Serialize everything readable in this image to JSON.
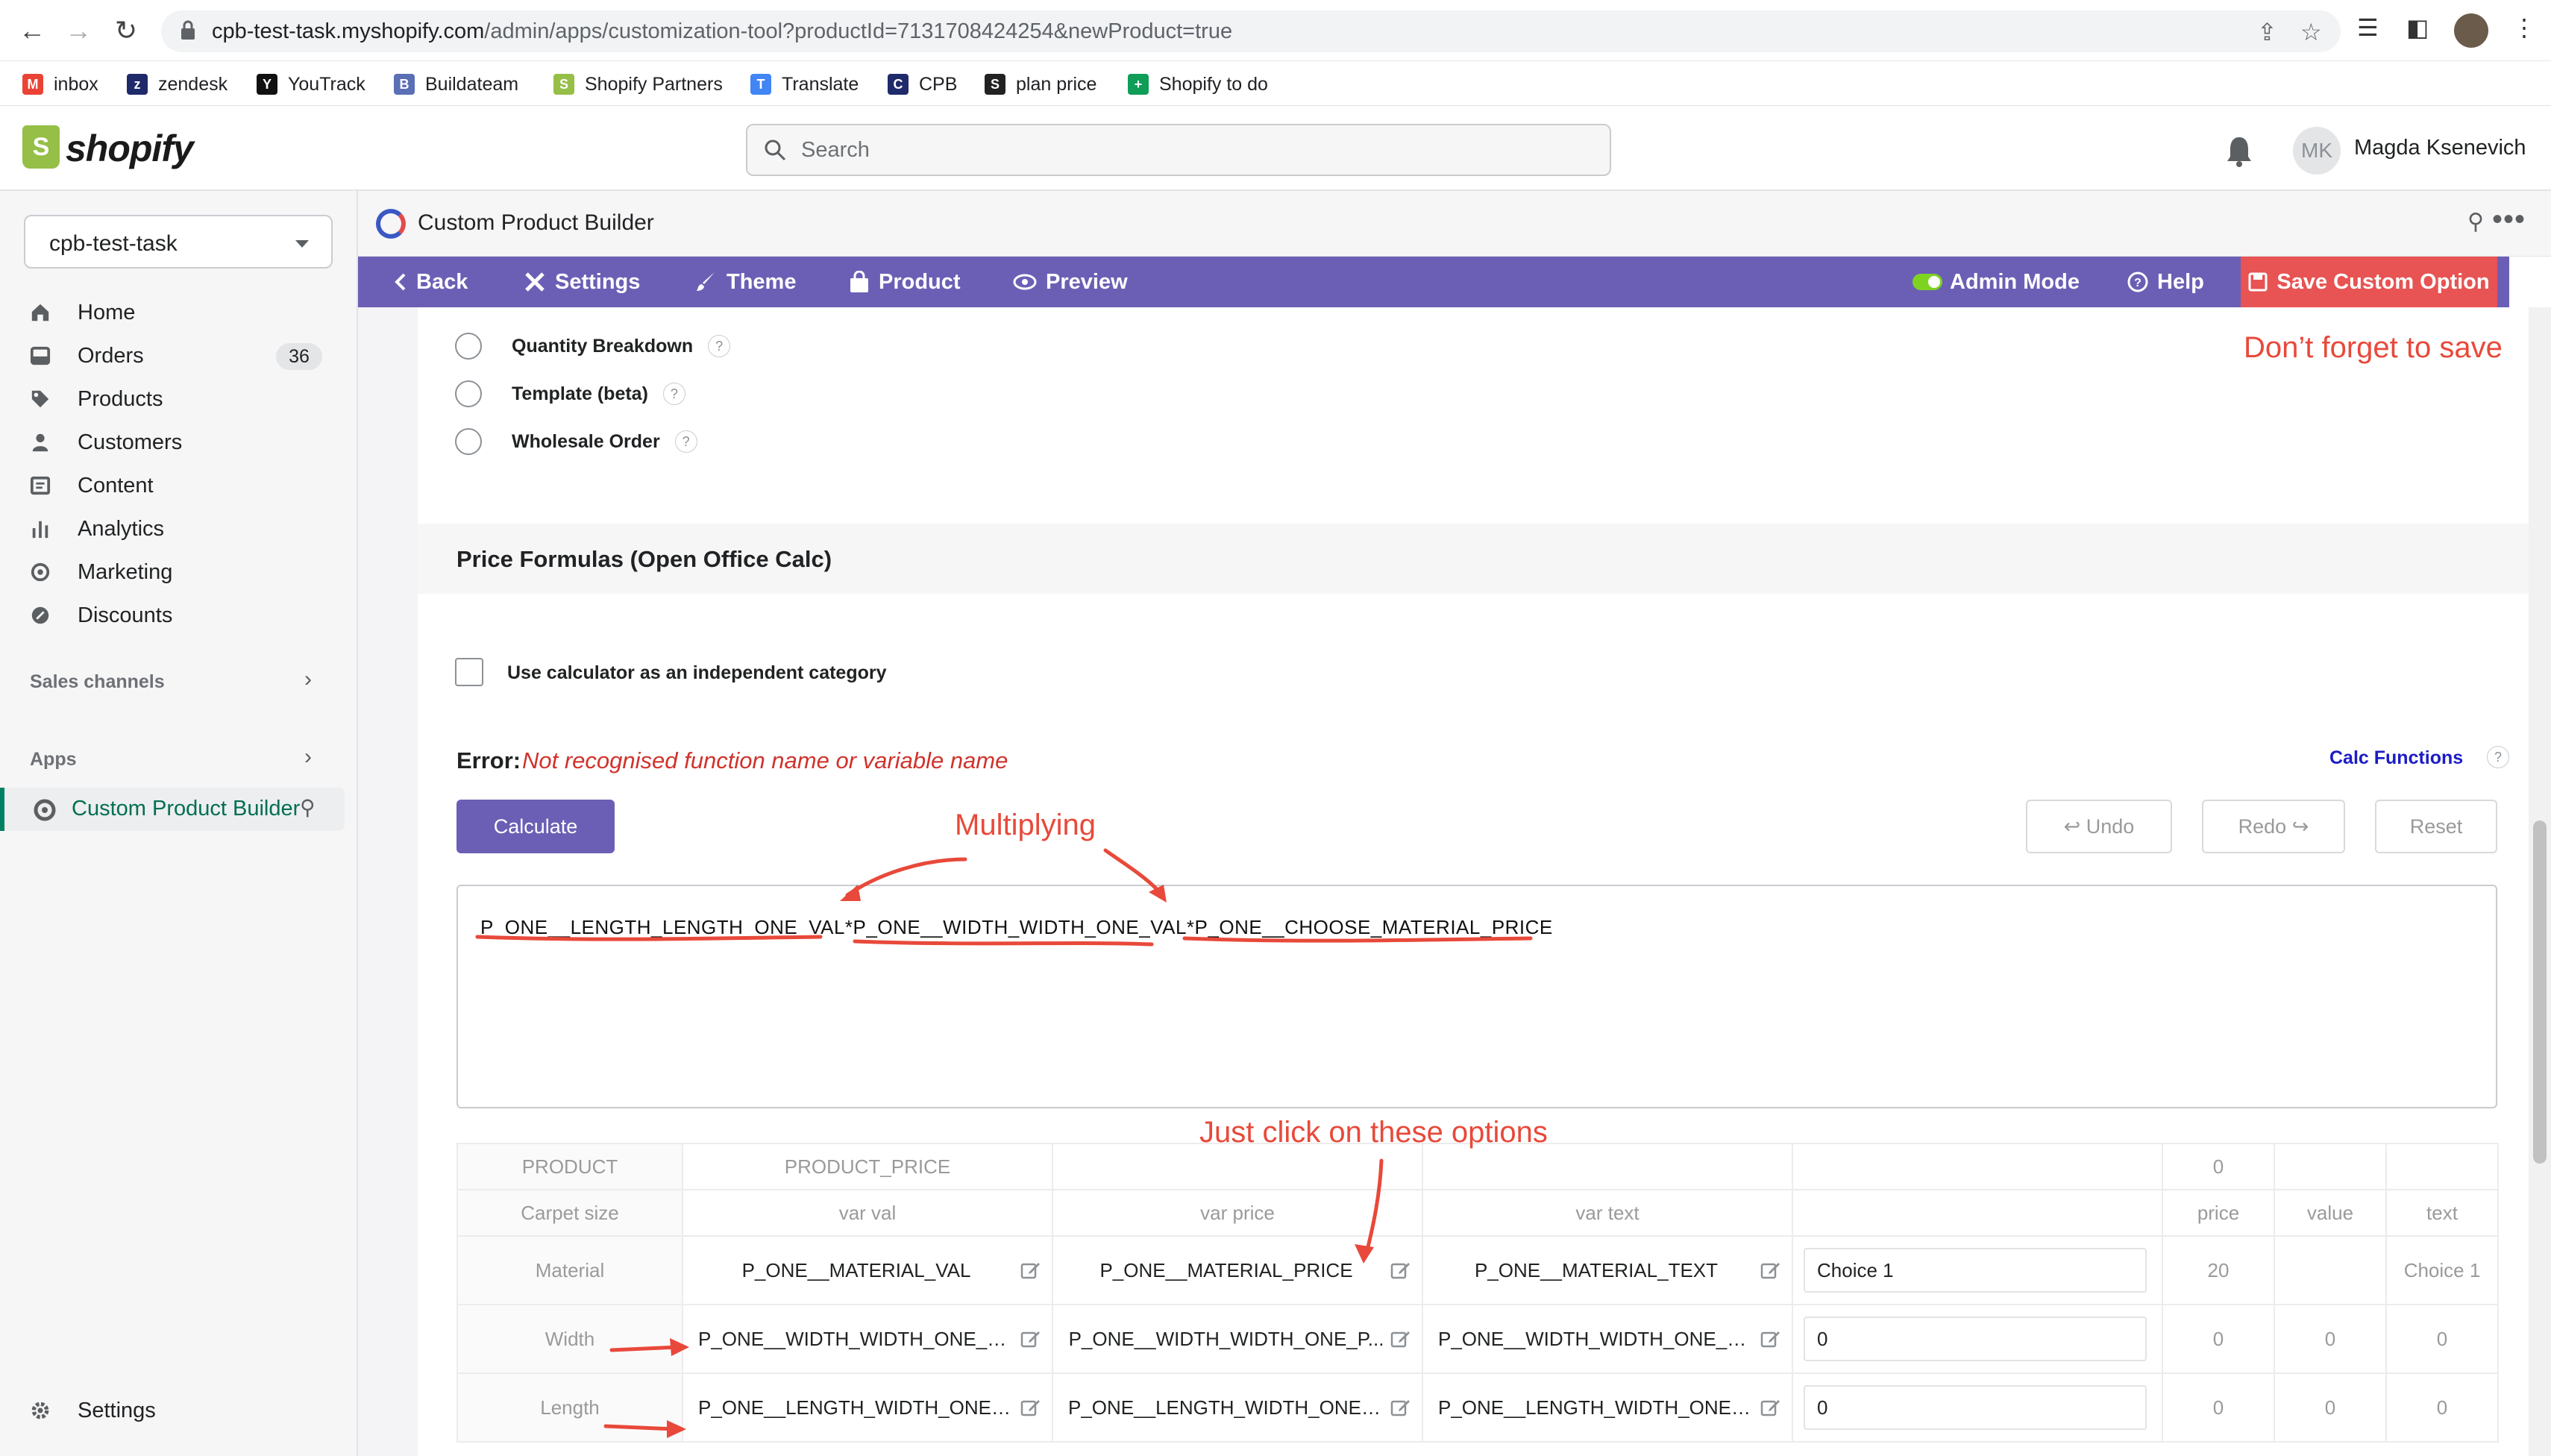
{
  "browser": {
    "url_host": "cpb-test-task.myshopify.com",
    "url_path": "/admin/apps/customization-tool?productId=7131708424254&newProduct=true",
    "bookmarks": [
      {
        "label": "inbox",
        "color": "#ea4335",
        "glyph": "M"
      },
      {
        "label": "zendesk",
        "color": "#1f2a6b",
        "glyph": "z"
      },
      {
        "label": "YouTrack",
        "color": "#111111",
        "glyph": "Y"
      },
      {
        "label": "Buildateam",
        "color": "#5b6fb5",
        "glyph": "B"
      },
      {
        "label": "Shopify Partners",
        "color": "#95bf47",
        "glyph": "S"
      },
      {
        "label": "Translate",
        "color": "#4285f4",
        "glyph": "T"
      },
      {
        "label": "CPB",
        "color": "#1f2a6b",
        "glyph": "C"
      },
      {
        "label": "plan price",
        "color": "#222222",
        "glyph": "S"
      },
      {
        "label": "Shopify to do",
        "color": "#0f9d58",
        "glyph": "+"
      }
    ]
  },
  "shopify": {
    "logo_text": "shopify",
    "search_placeholder": "Search",
    "user_initials": "MK",
    "user_name": "Magda Ksenevich"
  },
  "sidebar": {
    "store": "cpb-test-task",
    "items": [
      {
        "label": "Home",
        "icon": "home-icon"
      },
      {
        "label": "Orders",
        "icon": "orders-icon",
        "badge": "36"
      },
      {
        "label": "Products",
        "icon": "tag-icon"
      },
      {
        "label": "Customers",
        "icon": "person-icon"
      },
      {
        "label": "Content",
        "icon": "content-icon"
      },
      {
        "label": "Analytics",
        "icon": "analytics-icon"
      },
      {
        "label": "Marketing",
        "icon": "marketing-icon"
      },
      {
        "label": "Discounts",
        "icon": "discount-icon"
      }
    ],
    "sales_channels": "Sales channels",
    "apps": "Apps",
    "active_app": "Custom Product Builder",
    "settings": "Settings"
  },
  "app": {
    "title": "Custom Product Builder",
    "toolbar": {
      "back": "Back",
      "settings": "Settings",
      "theme": "Theme",
      "product": "Product",
      "preview": "Preview",
      "admin_mode": "Admin Mode",
      "help": "Help",
      "save": "Save Custom Option"
    },
    "options": [
      {
        "label": "Quantity Breakdown"
      },
      {
        "label": "Template (beta)"
      },
      {
        "label": "Wholesale Order"
      }
    ],
    "section_title": "Price Formulas (Open Office Calc)",
    "calc_checkbox_label": "Use calculator as an independent category",
    "error_label": "Error:",
    "error_message": "Not recognised function name or variable name",
    "calc_functions": "Calc Functions",
    "buttons": {
      "calculate": "Calculate",
      "undo": "↩ Undo",
      "redo": "Redo ↪",
      "reset": "Reset"
    },
    "formula": "P_ONE__LENGTH_LENGTH_ONE_VAL*P_ONE__WIDTH_WIDTH_ONE_VAL*P_ONE__CHOOSE_MATERIAL_PRICE",
    "table": {
      "header1": {
        "product": "PRODUCT",
        "product_price": "PRODUCT_PRICE",
        "qty": "0"
      },
      "header2": {
        "name": "Carpet size",
        "var_val": "var val",
        "var_price": "var price",
        "var_text": "var text",
        "price": "price",
        "value": "value",
        "text": "text"
      },
      "rows": [
        {
          "name": "Material",
          "var_val": "P_ONE__MATERIAL_VAL",
          "var_price": "P_ONE__MATERIAL_PRICE",
          "var_text": "P_ONE__MATERIAL_TEXT",
          "input": "Choice 1",
          "price": "20",
          "value": "",
          "text": "Choice 1"
        },
        {
          "name": "Width",
          "var_val": "P_ONE__WIDTH_WIDTH_ONE_VAL",
          "var_price": "P_ONE__WIDTH_WIDTH_ONE_P...",
          "var_text": "P_ONE__WIDTH_WIDTH_ONE_TE...",
          "input": "0",
          "price": "0",
          "value": "0",
          "text": "0"
        },
        {
          "name": "Length",
          "var_val": "P_ONE__LENGTH_WIDTH_ONE_V...",
          "var_price": "P_ONE__LENGTH_WIDTH_ONE_P...",
          "var_text": "P_ONE__LENGTH_WIDTH_ONE_T...",
          "input": "0",
          "price": "0",
          "value": "0",
          "text": "0"
        }
      ]
    }
  },
  "annotations": {
    "save_note": "Don’t forget to save",
    "multiplying": "Multiplying",
    "click_options": "Just click on these options"
  },
  "colors": {
    "toolbar": "#6b5fb5",
    "save": "#e85353",
    "annotation": "#e8493a",
    "shopify_green": "#95bf47"
  }
}
